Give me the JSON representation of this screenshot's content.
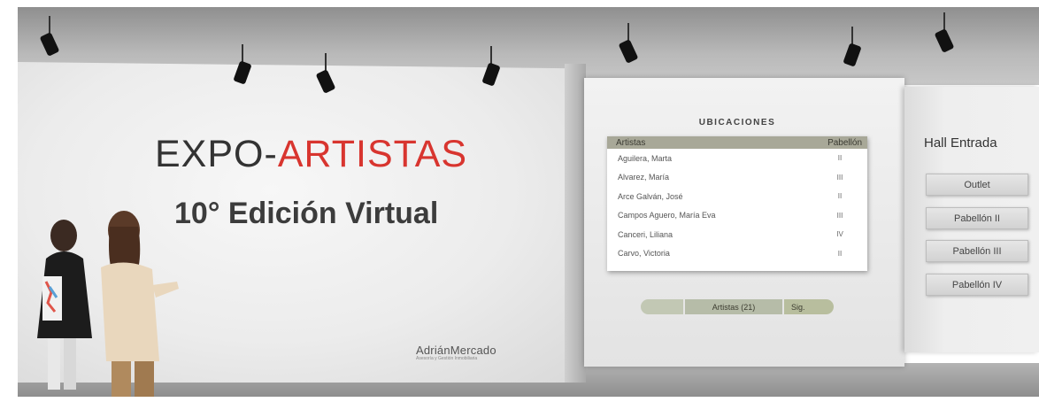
{
  "expo": {
    "title_part1": "EXPO-",
    "title_part2": "ARTISTAS",
    "subtitle": "10° Edición Virtual",
    "brand_name": "AdriánMercado",
    "brand_tagline": "Asesoría y Gestión Inmobiliaria"
  },
  "locations": {
    "heading": "UBICACIONES",
    "columns": [
      "Artistas",
      "Pabellón"
    ],
    "rows": [
      {
        "artist": "Aguilera, Marta",
        "pavilion": "II"
      },
      {
        "artist": "Alvarez, María",
        "pavilion": "III"
      },
      {
        "artist": "Arce Galván, José",
        "pavilion": "II"
      },
      {
        "artist": "Campos Aguero, María Eva",
        "pavilion": "III"
      },
      {
        "artist": "Canceri, Liliana",
        "pavilion": "IV"
      },
      {
        "artist": "Carvo, Victoria",
        "pavilion": "II"
      }
    ],
    "pager": {
      "count_label": "Artistas (21)",
      "next_label": "Sig."
    }
  },
  "hall": {
    "title": "Hall Entrada",
    "buttons": [
      "Outlet",
      "Pabellón II",
      "Pabellón III",
      "Pabellón IV"
    ]
  },
  "colors": {
    "accent": "#d8352f",
    "header_band": "#a8a898",
    "pager": "#b6bca8"
  }
}
